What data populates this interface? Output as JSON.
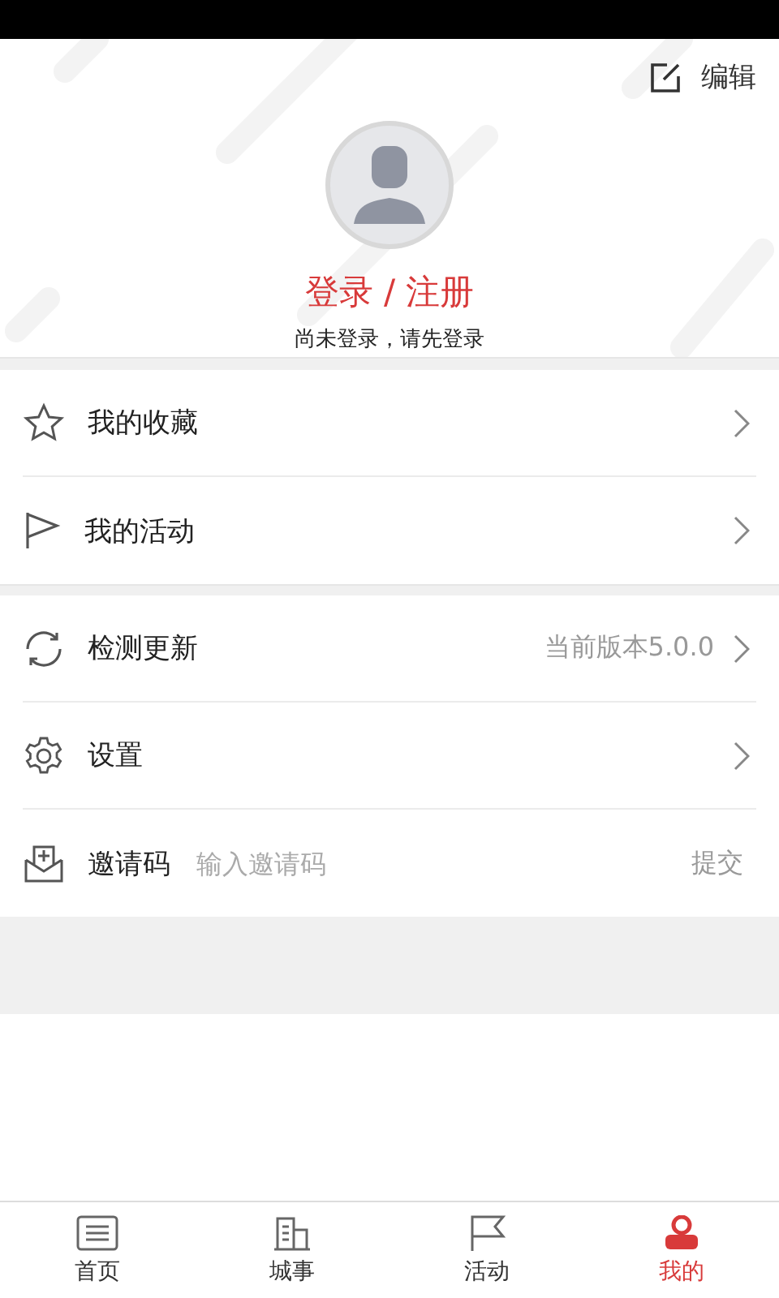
{
  "header": {
    "edit_label": "编辑",
    "login_label": "登录 / 注册",
    "login_hint": "尚未登录，请先登录"
  },
  "menu_groups": [
    {
      "items": [
        {
          "kind": "link",
          "label": "我的收藏"
        },
        {
          "kind": "link",
          "label": "我的活动"
        }
      ]
    },
    {
      "items": [
        {
          "kind": "link",
          "label": "检测更新",
          "value": "当前版本5.0.0"
        },
        {
          "kind": "link",
          "label": "设置"
        },
        {
          "kind": "invite",
          "label": "邀请码",
          "placeholder": "输入邀请码",
          "submit": "提交"
        }
      ]
    }
  ],
  "tab_bar": [
    {
      "label": "首页",
      "selected": false
    },
    {
      "label": "城事",
      "selected": false
    },
    {
      "label": "活动",
      "selected": false
    },
    {
      "label": "我的",
      "selected": true
    }
  ]
}
